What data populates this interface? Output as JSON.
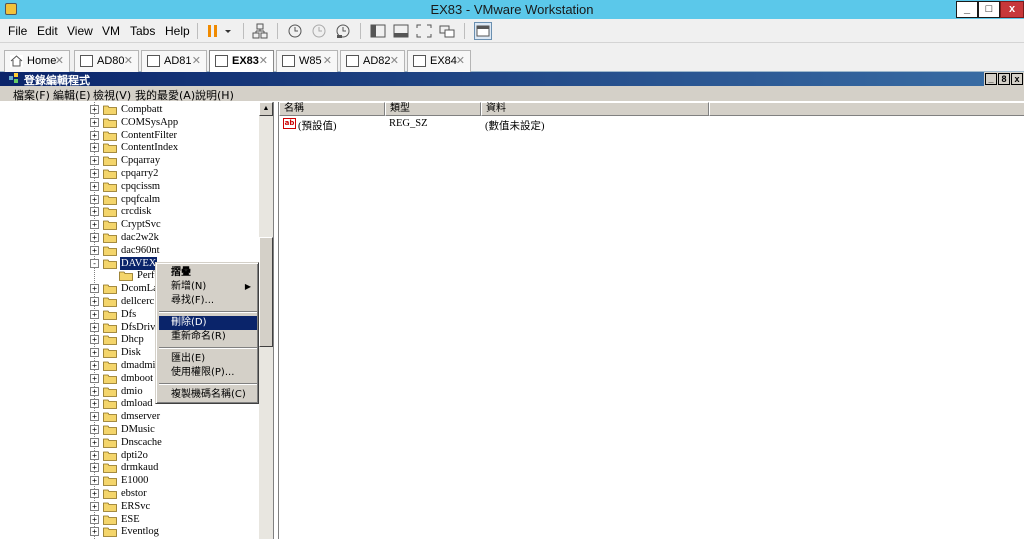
{
  "vmware": {
    "title": "EX83 - VMware Workstation",
    "window_controls": {
      "minimize": "_",
      "restore": "□",
      "close": "x"
    },
    "menu": [
      "File",
      "Edit",
      "View",
      "VM",
      "Tabs",
      "Help"
    ],
    "tabs": [
      {
        "label": "Home",
        "icon": "home-icon",
        "active": false
      },
      {
        "label": "AD80",
        "icon": "vm-icon",
        "active": false
      },
      {
        "label": "AD81",
        "icon": "vm-icon",
        "active": false
      },
      {
        "label": "EX83",
        "icon": "vm-icon",
        "active": true
      },
      {
        "label": "W85",
        "icon": "vm-icon",
        "active": false
      },
      {
        "label": "AD82",
        "icon": "vm-icon",
        "active": false
      },
      {
        "label": "EX84",
        "icon": "vm-icon",
        "active": false
      }
    ],
    "accent_color": "#5bc8ea"
  },
  "regedit": {
    "title": "登錄編輯程式",
    "window_controls": {
      "minimize": "_",
      "restore": "8",
      "close": "x"
    },
    "menu": [
      "檔案(F)",
      "編輯(E)",
      "檢視(V)",
      "我的最愛(A)",
      "說明(H)"
    ],
    "tree": [
      {
        "label": "Compbatt",
        "expander": "+"
      },
      {
        "label": "COMSysApp",
        "expander": "+"
      },
      {
        "label": "ContentFilter",
        "expander": "+"
      },
      {
        "label": "ContentIndex",
        "expander": "+"
      },
      {
        "label": "Cpqarray",
        "expander": "+"
      },
      {
        "label": "cpqarry2",
        "expander": "+"
      },
      {
        "label": "cpqcissm",
        "expander": "+"
      },
      {
        "label": "cpqfcalm",
        "expander": "+"
      },
      {
        "label": "crcdisk",
        "expander": "+"
      },
      {
        "label": "CryptSvc",
        "expander": "+"
      },
      {
        "label": "dac2w2k",
        "expander": "+"
      },
      {
        "label": "dac960nt",
        "expander": "+"
      },
      {
        "label": "DAVEX",
        "expander": "-",
        "selected": true
      },
      {
        "label": "Perfo",
        "expander": "",
        "child": true
      },
      {
        "label": "DcomLau",
        "expander": "+"
      },
      {
        "label": "dellcerc",
        "expander": "+"
      },
      {
        "label": "Dfs",
        "expander": "+"
      },
      {
        "label": "DfsDriver",
        "expander": "+"
      },
      {
        "label": "Dhcp",
        "expander": "+"
      },
      {
        "label": "Disk",
        "expander": "+"
      },
      {
        "label": "dmadmin",
        "expander": "+"
      },
      {
        "label": "dmboot",
        "expander": "+"
      },
      {
        "label": "dmio",
        "expander": "+"
      },
      {
        "label": "dmload",
        "expander": "+"
      },
      {
        "label": "dmserver",
        "expander": "+"
      },
      {
        "label": "DMusic",
        "expander": "+"
      },
      {
        "label": "Dnscache",
        "expander": "+"
      },
      {
        "label": "dpti2o",
        "expander": "+"
      },
      {
        "label": "drmkaud",
        "expander": "+"
      },
      {
        "label": "E1000",
        "expander": "+"
      },
      {
        "label": "ebstor",
        "expander": "+"
      },
      {
        "label": "ERSvc",
        "expander": "+"
      },
      {
        "label": "ESE",
        "expander": "+"
      },
      {
        "label": "Eventlog",
        "expander": "+"
      }
    ],
    "columns": [
      "名稱",
      "類型",
      "資料"
    ],
    "values": [
      {
        "icon": "ab",
        "name": "(預設值)",
        "type": "REG_SZ",
        "data": "(數值未設定)"
      }
    ],
    "context_menu": [
      {
        "label": "摺疊",
        "bold": true
      },
      {
        "label": "新增(N)",
        "submenu": true
      },
      {
        "label": "尋找(F)..."
      },
      {
        "separator": true
      },
      {
        "label": "刪除(D)",
        "highlighted": true
      },
      {
        "label": "重新命名(R)"
      },
      {
        "separator": true
      },
      {
        "label": "匯出(E)"
      },
      {
        "label": "使用權限(P)..."
      },
      {
        "separator": true
      },
      {
        "label": "複製機碼名稱(C)"
      }
    ]
  }
}
